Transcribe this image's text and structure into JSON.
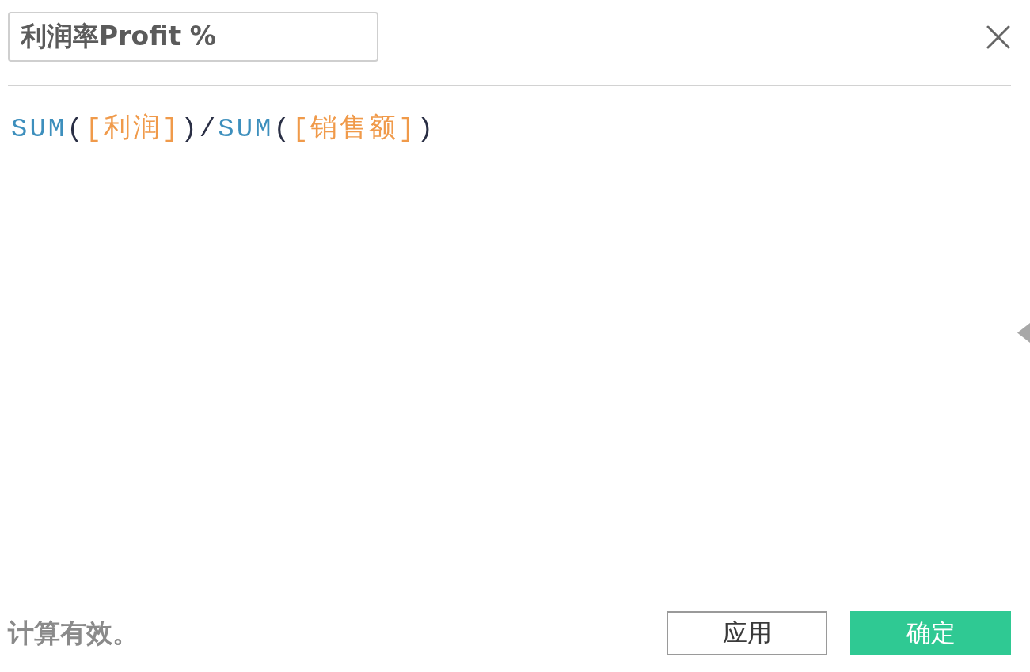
{
  "header": {
    "name_field": {
      "value": "利润率Profit %"
    }
  },
  "formula": {
    "tokens": [
      {
        "kind": "function",
        "text": "SUM"
      },
      {
        "kind": "paren",
        "text": "("
      },
      {
        "kind": "field",
        "text": "[利润]"
      },
      {
        "kind": "paren",
        "text": ")"
      },
      {
        "kind": "operator",
        "text": "/"
      },
      {
        "kind": "function",
        "text": "SUM"
      },
      {
        "kind": "paren",
        "text": "("
      },
      {
        "kind": "field",
        "text": "[销售额]"
      },
      {
        "kind": "paren",
        "text": ")"
      }
    ]
  },
  "side_panel": {
    "expanded": false
  },
  "footer": {
    "status": "计算有效。",
    "buttons": [
      {
        "label": "应用",
        "kind": "secondary"
      },
      {
        "label": "确定",
        "kind": "primary"
      }
    ]
  }
}
